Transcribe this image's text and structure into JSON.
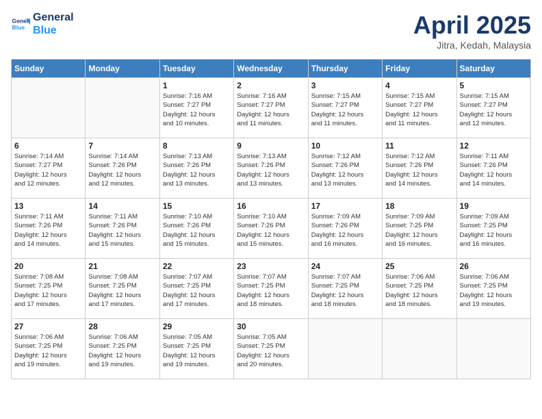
{
  "header": {
    "logo_line1": "General",
    "logo_line2": "Blue",
    "month_title": "April 2025",
    "subtitle": "Jitra, Kedah, Malaysia"
  },
  "weekdays": [
    "Sunday",
    "Monday",
    "Tuesday",
    "Wednesday",
    "Thursday",
    "Friday",
    "Saturday"
  ],
  "weeks": [
    [
      {
        "day": "",
        "info": ""
      },
      {
        "day": "",
        "info": ""
      },
      {
        "day": "1",
        "info": "Sunrise: 7:16 AM\nSunset: 7:27 PM\nDaylight: 12 hours\nand 10 minutes."
      },
      {
        "day": "2",
        "info": "Sunrise: 7:16 AM\nSunset: 7:27 PM\nDaylight: 12 hours\nand 11 minutes."
      },
      {
        "day": "3",
        "info": "Sunrise: 7:15 AM\nSunset: 7:27 PM\nDaylight: 12 hours\nand 11 minutes."
      },
      {
        "day": "4",
        "info": "Sunrise: 7:15 AM\nSunset: 7:27 PM\nDaylight: 12 hours\nand 11 minutes."
      },
      {
        "day": "5",
        "info": "Sunrise: 7:15 AM\nSunset: 7:27 PM\nDaylight: 12 hours\nand 12 minutes."
      }
    ],
    [
      {
        "day": "6",
        "info": "Sunrise: 7:14 AM\nSunset: 7:27 PM\nDaylight: 12 hours\nand 12 minutes."
      },
      {
        "day": "7",
        "info": "Sunrise: 7:14 AM\nSunset: 7:26 PM\nDaylight: 12 hours\nand 12 minutes."
      },
      {
        "day": "8",
        "info": "Sunrise: 7:13 AM\nSunset: 7:26 PM\nDaylight: 12 hours\nand 13 minutes."
      },
      {
        "day": "9",
        "info": "Sunrise: 7:13 AM\nSunset: 7:26 PM\nDaylight: 12 hours\nand 13 minutes."
      },
      {
        "day": "10",
        "info": "Sunrise: 7:12 AM\nSunset: 7:26 PM\nDaylight: 12 hours\nand 13 minutes."
      },
      {
        "day": "11",
        "info": "Sunrise: 7:12 AM\nSunset: 7:26 PM\nDaylight: 12 hours\nand 14 minutes."
      },
      {
        "day": "12",
        "info": "Sunrise: 7:11 AM\nSunset: 7:26 PM\nDaylight: 12 hours\nand 14 minutes."
      }
    ],
    [
      {
        "day": "13",
        "info": "Sunrise: 7:11 AM\nSunset: 7:26 PM\nDaylight: 12 hours\nand 14 minutes."
      },
      {
        "day": "14",
        "info": "Sunrise: 7:11 AM\nSunset: 7:26 PM\nDaylight: 12 hours\nand 15 minutes."
      },
      {
        "day": "15",
        "info": "Sunrise: 7:10 AM\nSunset: 7:26 PM\nDaylight: 12 hours\nand 15 minutes."
      },
      {
        "day": "16",
        "info": "Sunrise: 7:10 AM\nSunset: 7:26 PM\nDaylight: 12 hours\nand 15 minutes."
      },
      {
        "day": "17",
        "info": "Sunrise: 7:09 AM\nSunset: 7:26 PM\nDaylight: 12 hours\nand 16 minutes."
      },
      {
        "day": "18",
        "info": "Sunrise: 7:09 AM\nSunset: 7:25 PM\nDaylight: 12 hours\nand 16 minutes."
      },
      {
        "day": "19",
        "info": "Sunrise: 7:09 AM\nSunset: 7:25 PM\nDaylight: 12 hours\nand 16 minutes."
      }
    ],
    [
      {
        "day": "20",
        "info": "Sunrise: 7:08 AM\nSunset: 7:25 PM\nDaylight: 12 hours\nand 17 minutes."
      },
      {
        "day": "21",
        "info": "Sunrise: 7:08 AM\nSunset: 7:25 PM\nDaylight: 12 hours\nand 17 minutes."
      },
      {
        "day": "22",
        "info": "Sunrise: 7:07 AM\nSunset: 7:25 PM\nDaylight: 12 hours\nand 17 minutes."
      },
      {
        "day": "23",
        "info": "Sunrise: 7:07 AM\nSunset: 7:25 PM\nDaylight: 12 hours\nand 18 minutes."
      },
      {
        "day": "24",
        "info": "Sunrise: 7:07 AM\nSunset: 7:25 PM\nDaylight: 12 hours\nand 18 minutes."
      },
      {
        "day": "25",
        "info": "Sunrise: 7:06 AM\nSunset: 7:25 PM\nDaylight: 12 hours\nand 18 minutes."
      },
      {
        "day": "26",
        "info": "Sunrise: 7:06 AM\nSunset: 7:25 PM\nDaylight: 12 hours\nand 19 minutes."
      }
    ],
    [
      {
        "day": "27",
        "info": "Sunrise: 7:06 AM\nSunset: 7:25 PM\nDaylight: 12 hours\nand 19 minutes."
      },
      {
        "day": "28",
        "info": "Sunrise: 7:06 AM\nSunset: 7:25 PM\nDaylight: 12 hours\nand 19 minutes."
      },
      {
        "day": "29",
        "info": "Sunrise: 7:05 AM\nSunset: 7:25 PM\nDaylight: 12 hours\nand 19 minutes."
      },
      {
        "day": "30",
        "info": "Sunrise: 7:05 AM\nSunset: 7:25 PM\nDaylight: 12 hours\nand 20 minutes."
      },
      {
        "day": "",
        "info": ""
      },
      {
        "day": "",
        "info": ""
      },
      {
        "day": "",
        "info": ""
      }
    ]
  ]
}
